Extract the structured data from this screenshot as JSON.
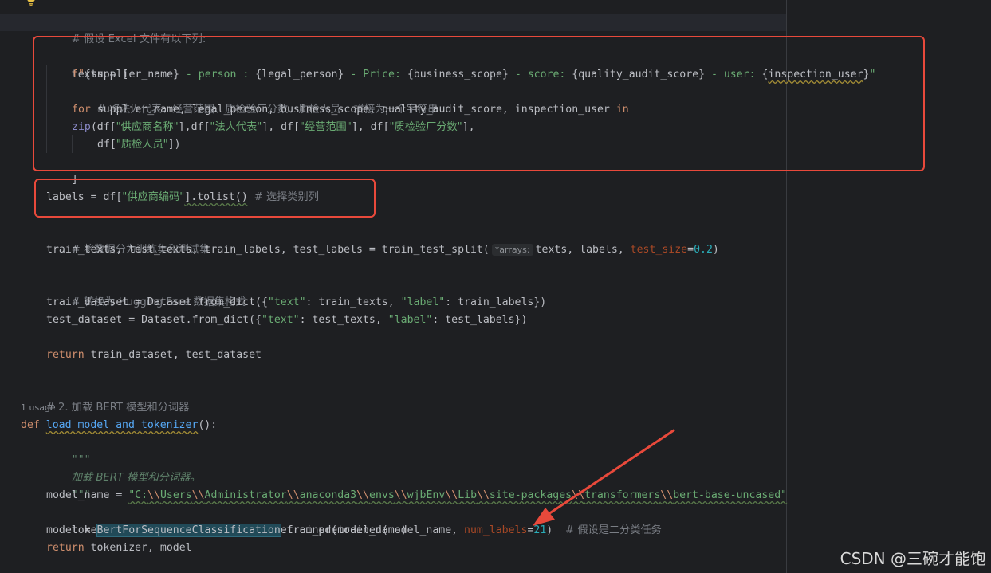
{
  "colors": {
    "background": "#1e1f22",
    "keyword": "#cf8e6d",
    "string": "#6aab73",
    "comment": "#7a7e85",
    "function": "#56a8f5",
    "parameter": "#aa4926",
    "number": "#2aacb8",
    "annotation_red": "#e8493b"
  },
  "icons": {
    "bulb": "lightbulb-icon"
  },
  "code": {
    "l1_comment": "# 假设 Excel 文件有以下列:",
    "l2_a": "texts = [",
    "l3": {
      "f": "f\"",
      "v1": "{supplier_name}",
      "s1": " - person : ",
      "v2": "{legal_person}",
      "s2": " - Price: ",
      "v3": "{business_scope}",
      "s3": " - score: ",
      "v4": "{quality_audit_score}",
      "s4": " - user: ",
      "v5_open": "{",
      "v5_name": "inspection_user",
      "v5_close": "}",
      "end": "\""
    },
    "l4_comment": "# 将法人代表、经营范围、质检验厂分数、质检人员    拼接为一个字符串",
    "l5": {
      "for": "for",
      "vars": " supplier_name, legal_person, business_scope, quality_audit_score, inspection_user ",
      "in": "in"
    },
    "l6": {
      "zip": "zip",
      "a": "(df[",
      "s1": "\"供应商名称\"",
      "b": "],",
      "c": "df[",
      "s2": "\"法人代表\"",
      "d": "], df[",
      "s3": "\"经营范围\"",
      "e": "], df[",
      "s4": "\"质检验厂分数\"",
      "f": "],"
    },
    "l7": {
      "a": "df[",
      "s": "\"质检人员\"",
      "b": "])"
    },
    "l8": "]",
    "l9": {
      "a": "labels = df[",
      "s": "\"供应商编码\"",
      "b": "].tolist()",
      "gap": " ",
      "cmt": "# 选择类别列"
    },
    "l10_comment": "# 将数据分为训练集和测试集",
    "l11": {
      "a": "train_texts, test_texts, train_labels, test_labels = train_test_split(",
      "hint": "*arrays:",
      "b": "texts, labels, ",
      "p": "test_size",
      "eq": "=",
      "n": "0.2",
      "c": ")"
    },
    "l12_comment": "# 转换为 Hugging Face 数据集格式",
    "l13": {
      "a": "train_dataset = Dataset.from_dict({",
      "s1": "\"text\"",
      "b": ": train_texts, ",
      "s2": "\"label\"",
      "c": ": train_labels})"
    },
    "l14": {
      "a": "test_dataset = Dataset.from_dict({",
      "s1": "\"text\"",
      "b": ": test_texts, ",
      "s2": "\"label\"",
      "c": ": test_labels})"
    },
    "l15": {
      "kw": "return",
      "rest": " train_dataset, test_dataset"
    },
    "l16_comment": "# 2. 加载 BERT 模型和分词器",
    "usage": "1 usage",
    "l17": {
      "kw": "def",
      "sp": " ",
      "fn": "load_model_and_tokenizer",
      "rest": "():"
    },
    "l18_doc": "\"\"\"",
    "l19_doc": "加载 BERT 模型和分词器。",
    "l20_doc": "\"\"\"",
    "l21": {
      "a": "model_name = ",
      "q": "\"C:",
      "e1": "\\\\",
      "p1": "Users",
      "e2": "\\\\",
      "p2": "Administrator",
      "e3": "\\\\",
      "p3": "anaconda3",
      "e4": "\\\\",
      "p4": "envs",
      "e5": "\\\\",
      "p5": "wjbEnv",
      "e6": "\\\\",
      "p6": "Lib",
      "e7": "\\\\",
      "p7": "site-packages",
      "e8": "\\\\",
      "p8": "transformers",
      "e9": "\\\\",
      "p9": "bert-base-uncased\""
    },
    "l22": "tokenizer = BertTokenizer.from_pretrained(model_name)",
    "l23": {
      "a": "model = ",
      "cls": "BertForSequenceClassification",
      "b": ".from_pretrained(model_name, ",
      "p": "num_labels",
      "eq": "=",
      "n": "21",
      "c": ")  ",
      "cmt": "# 假设是二分类任务"
    },
    "l24": {
      "kw": "return",
      "rest": " tokenizer, model"
    }
  },
  "watermark": "CSDN @三碗才能饱"
}
